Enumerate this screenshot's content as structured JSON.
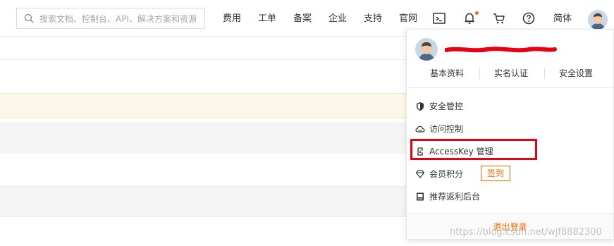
{
  "search": {
    "placeholder": "搜索文档、控制台、API、解决方案和资源"
  },
  "nav": {
    "items": [
      "费用",
      "工单",
      "备案",
      "企业",
      "支持",
      "官网"
    ],
    "lang": "简体"
  },
  "colors": {
    "accent": "#ff6a00",
    "highlight": "#e60012",
    "notice_bg": "#fcf8e9"
  },
  "icons": [
    "search-icon",
    "terminal-icon",
    "bell-icon",
    "cart-icon",
    "help-icon",
    "avatar"
  ],
  "dropdown": {
    "links": [
      "基本资料",
      "实名认证",
      "安全设置"
    ],
    "menu": [
      {
        "label": "安全管控",
        "icon": "shield-icon"
      },
      {
        "label": "访问控制",
        "icon": "cloud-icon"
      },
      {
        "label": "AccessKey 管理",
        "icon": "key-icon"
      },
      {
        "label": "会员积分",
        "icon": "diamond-icon"
      },
      {
        "label": "推荐返利后台",
        "icon": "book-icon"
      }
    ],
    "checkin": "签到",
    "logout": "退出登录"
  },
  "watermark": "https://blog.csdn.net/wjf8882300"
}
